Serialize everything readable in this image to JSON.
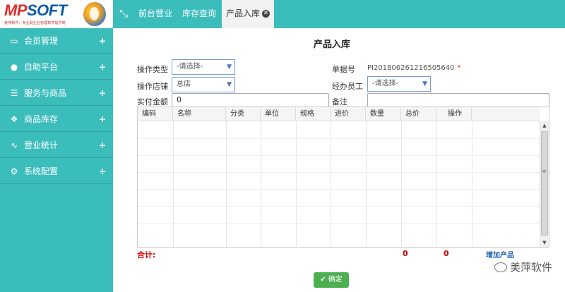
{
  "logo": {
    "brand_red": "MP",
    "brand_blue": "SOFT",
    "tagline": "美萍软件，专业助企业管理软件提供商"
  },
  "tabs": [
    {
      "label": "前台营业"
    },
    {
      "label": "库存查询"
    },
    {
      "label": "产品入库",
      "active": true
    }
  ],
  "sidebar": {
    "items": [
      {
        "label": "会员管理",
        "icon": "card-icon"
      },
      {
        "label": "自助平台",
        "icon": "user-circle-icon"
      },
      {
        "label": "服务与商品",
        "icon": "list-icon"
      },
      {
        "label": "商品库存",
        "icon": "boxes-icon"
      },
      {
        "label": "营业统计",
        "icon": "line-chart-icon"
      },
      {
        "label": "系统配置",
        "icon": "gears-icon"
      }
    ],
    "expand_symbol": "+"
  },
  "form": {
    "title": "产品入库",
    "op_type_label": "操作类型",
    "op_type_value": "-请选择-",
    "order_no_label": "单据号",
    "order_no_value": "PI2018062612165056​40",
    "required_mark": "*",
    "store_label": "操作店铺",
    "store_value": "总店",
    "staff_label": "经办员工",
    "staff_value": "-请选择-",
    "paid_label": "实付金额",
    "paid_value": "0",
    "remark_label": "备注",
    "remark_value": ""
  },
  "table": {
    "columns": [
      "编码",
      "名称",
      "分类",
      "单位",
      "规格",
      "进价",
      "数量",
      "总价",
      "操作"
    ]
  },
  "summary": {
    "total_label": "合计:",
    "qty_total": "0",
    "price_total": "0",
    "add_label": "增加产品"
  },
  "confirm_label": "确定",
  "watermark": "美萍软件",
  "colors": {
    "accent": "#3bbdbc",
    "confirm": "#4caf50",
    "total": "#cc0000",
    "link": "#1a5fb4"
  }
}
